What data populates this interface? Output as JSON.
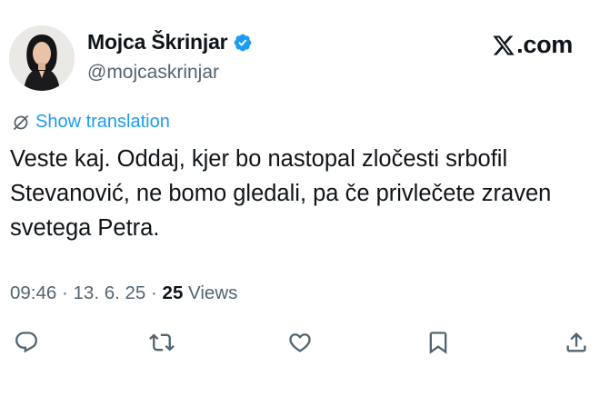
{
  "author": {
    "display_name": "Mojca Škrinjar",
    "handle": "@mojcaskrinjar",
    "verified": true
  },
  "brand": {
    "logo_text": ".com",
    "logo_icon": "x-logo-icon"
  },
  "translation": {
    "label": "Show translation",
    "icon": "translate-icon"
  },
  "tweet": {
    "text": "Veste kaj. Oddaj, kjer bo nastopal zločesti srbofil Stevanović, ne bomo gledali, pa če privlečete zraven svetega Petra."
  },
  "meta": {
    "time": "09:46",
    "separator": " · ",
    "date": "13. 6. 25",
    "views_count": "25",
    "views_label": " Views"
  },
  "actions": [
    {
      "name": "reply",
      "icon": "reply-icon"
    },
    {
      "name": "retweet",
      "icon": "retweet-icon"
    },
    {
      "name": "like",
      "icon": "heart-icon"
    },
    {
      "name": "bookmark",
      "icon": "bookmark-icon"
    },
    {
      "name": "share",
      "icon": "share-icon"
    }
  ],
  "colors": {
    "text": "#0f1419",
    "secondary": "#536471",
    "accent": "#1d9bf0",
    "background": "#ffffff"
  }
}
